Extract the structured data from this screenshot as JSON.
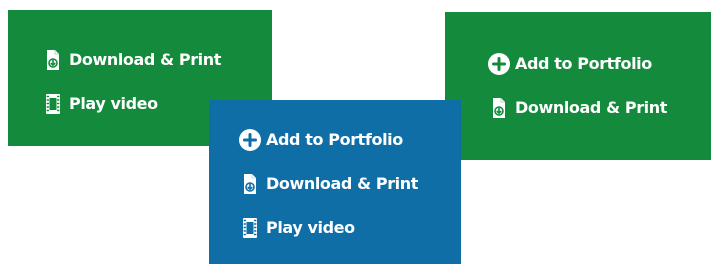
{
  "colors": {
    "green": "#138a3c",
    "blue": "#0f6ea5",
    "white": "#ffffff"
  },
  "panels": {
    "left": {
      "download_print_label": "Download & Print",
      "play_video_label": "Play video",
      "download_icon": "document-download-icon",
      "video_icon": "film-strip-icon"
    },
    "right": {
      "add_portfolio_label": "Add to Portfolio",
      "download_print_label": "Download & Print",
      "add_icon": "plus-circle-icon",
      "download_icon": "document-download-icon"
    },
    "center": {
      "add_portfolio_label": "Add to Portfolio",
      "download_print_label": "Download & Print",
      "play_video_label": "Play video",
      "add_icon": "plus-circle-icon",
      "download_icon": "document-download-icon",
      "video_icon": "film-strip-icon"
    }
  }
}
